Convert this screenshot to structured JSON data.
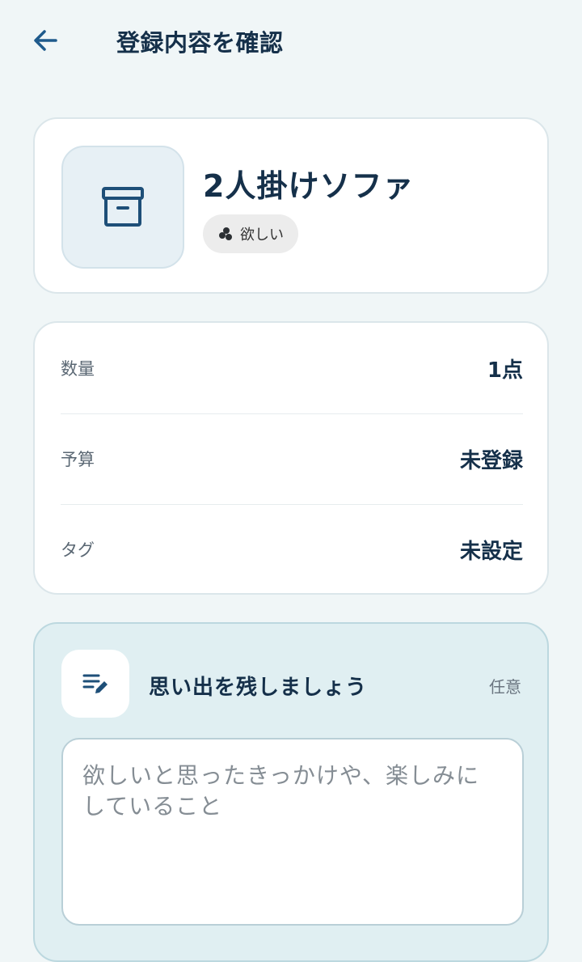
{
  "header": {
    "title": "登録内容を確認",
    "back_icon": "arrow-left-icon"
  },
  "item": {
    "name": "2人掛けソファ",
    "thumbnail_icon": "archive-box-icon",
    "status": {
      "icon": "seeds-icon",
      "label": "欲しい"
    }
  },
  "details": [
    {
      "key": "数量",
      "value": "1点"
    },
    {
      "key": "予算",
      "value": "未登録"
    },
    {
      "key": "タグ",
      "value": "未設定"
    }
  ],
  "memo": {
    "icon": "note-edit-icon",
    "title": "思い出を残しましょう",
    "optional_label": "任意",
    "placeholder": "欲しいと思ったきっかけや、楽しみにしていること"
  },
  "colors": {
    "background": "#f0f6f7",
    "primary_text": "#15304a",
    "accent": "#1e5a8c",
    "memo_background": "#e0eff2"
  }
}
